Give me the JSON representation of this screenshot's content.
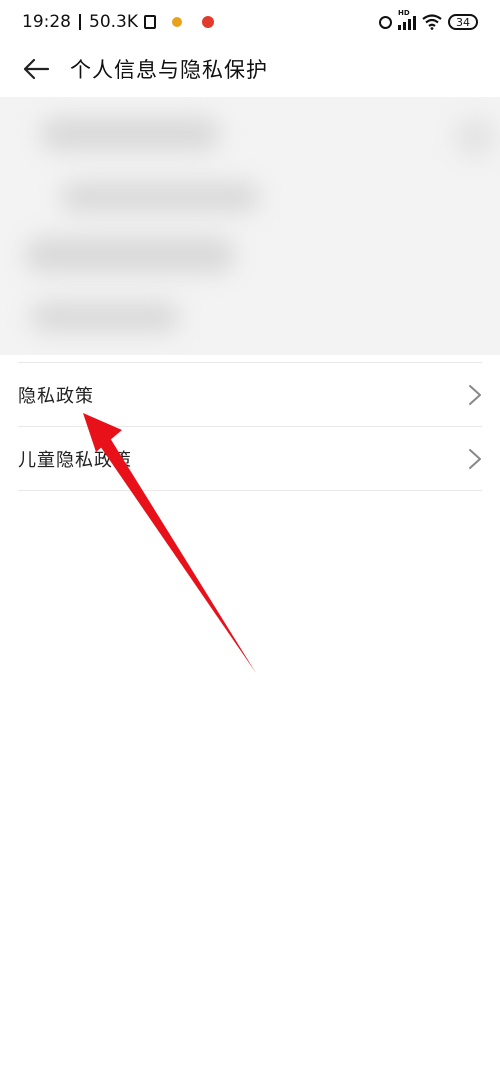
{
  "status_bar": {
    "time": "19:28",
    "net_speed": "50.3K",
    "battery": "34"
  },
  "header": {
    "title": "个人信息与隐私保护",
    "back_icon": "back-arrow-icon"
  },
  "list": {
    "items": [
      {
        "label": "隐私政策"
      },
      {
        "label": "儿童隐私政策"
      }
    ]
  },
  "colors": {
    "annotation_arrow": "#e8111a",
    "divider": "#e9e9e9"
  }
}
